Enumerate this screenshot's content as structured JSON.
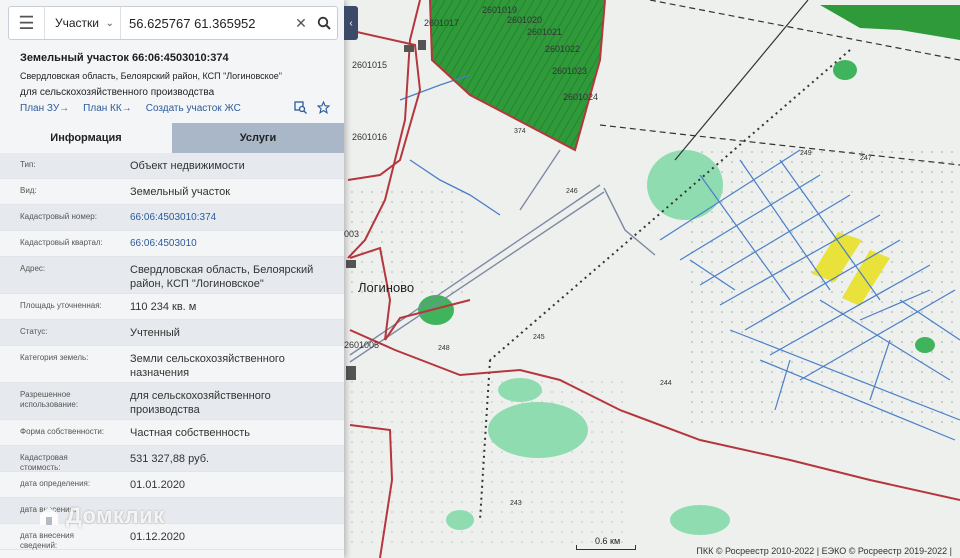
{
  "search": {
    "layer": "Участки",
    "query": "56.625767 61.365952"
  },
  "parcel": {
    "title": "Земельный участок 66:06:4503010:374",
    "address_short": "Свердловская область, Белоярский район, КСП \"Логиновское\"",
    "usage": "для сельскохозяйственного производства"
  },
  "links": [
    "План ЗУ",
    "План КК",
    "Создать участок ЖС"
  ],
  "tabs": {
    "info": "Информация",
    "services": "Услуги"
  },
  "rows": [
    {
      "key": "Тип:",
      "value": "Объект недвижимости"
    },
    {
      "key": "Вид:",
      "value": "Земельный участок"
    },
    {
      "key": "Кадастровый номер:",
      "value": "66:06:4503010:374",
      "link": true
    },
    {
      "key": "Кадастровый квартал:",
      "value": "66:06:4503010",
      "link": true
    },
    {
      "key": "Адрес:",
      "value": "Свердловская область, Белоярский район, КСП \"Логиновское\""
    },
    {
      "key": "Площадь уточненная:",
      "value": "110 234 кв. м"
    },
    {
      "key": "Статус:",
      "value": "Учтенный"
    },
    {
      "key": "Категория земель:",
      "value": "Земли сельскохозяйственного назначения"
    },
    {
      "key": "Разрешенное использование:",
      "value": "для сельскохозяйственного производства"
    },
    {
      "key": "Форма собственности:",
      "value": "Частная собственность"
    },
    {
      "key": "Кадастровая стоимость:",
      "value": "531 327,88 руб."
    },
    {
      "key": "дата определения:",
      "value": "01.01.2020"
    },
    {
      "key": "дата внесения:",
      "value": ""
    },
    {
      "key": "дата внесения сведений:",
      "value": "01.12.2020"
    }
  ],
  "watermark": "Домклик",
  "map": {
    "place_name": "Логиново",
    "scale": "0.6 км",
    "copyright": "ПКК © Росреестр 2010-2022 | ЕЭКО © Росреестр 2019-2022 |",
    "parcel_labels": [
      "2601017",
      "2601019",
      "2601020",
      "2601021",
      "2601022",
      "2601023",
      "2601024",
      "2601015",
      "2601016",
      "2601005",
      "003"
    ],
    "point_labels": [
      "374",
      "248",
      "244",
      "247",
      "249",
      "246",
      "245",
      "243"
    ]
  },
  "colors": {
    "panel_bg": "#f4f5f6",
    "tab_inactive": "#a9b7c8",
    "link": "#2a5b9c",
    "boundary_red": "#b5373d",
    "forest_green": "#2f9a3a",
    "light_green": "#8fdcb0",
    "field_yellow": "#e8e23a",
    "water_blue": "#4a7fc8"
  }
}
